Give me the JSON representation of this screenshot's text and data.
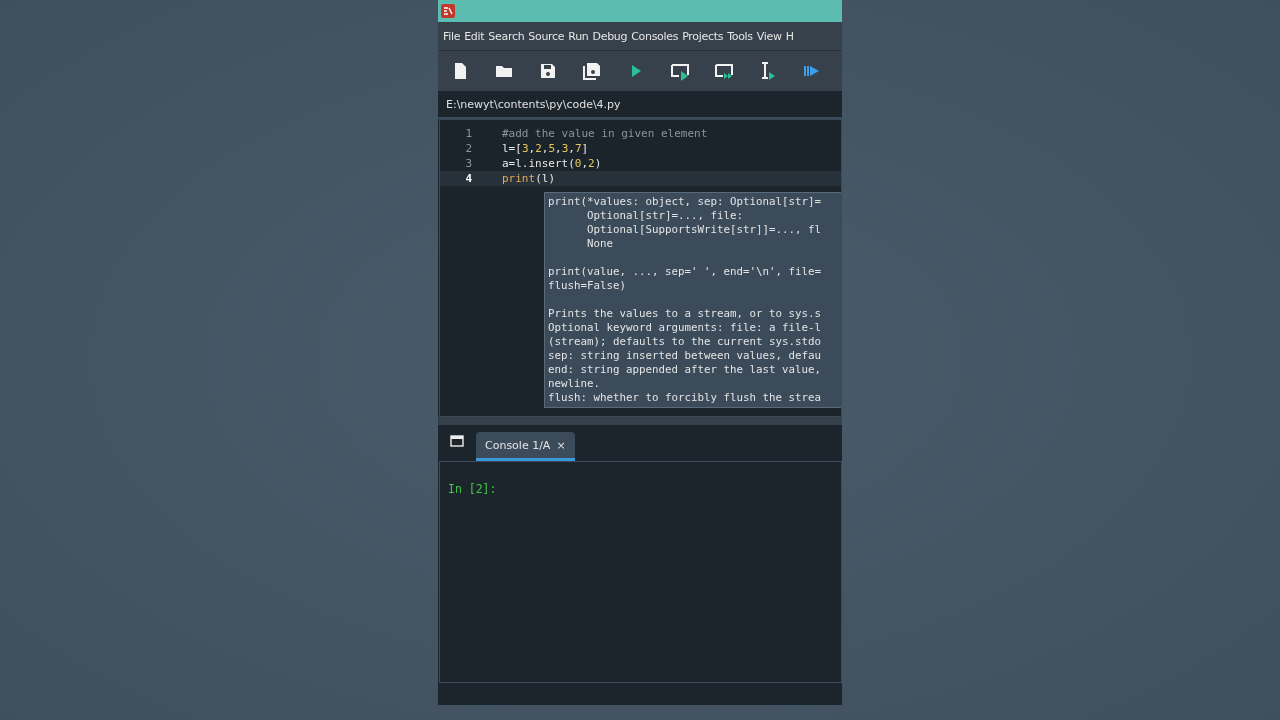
{
  "menu": [
    "File",
    "Edit",
    "Search",
    "Source",
    "Run",
    "Debug",
    "Consoles",
    "Projects",
    "Tools",
    "View",
    "H"
  ],
  "file_path": "E:\\newyt\\contents\\py\\code\\4.py",
  "editor": {
    "lines": [
      {
        "number": "1",
        "current": false,
        "tokens": [
          {
            "text": "#add the value in given element",
            "kind": "comment"
          }
        ]
      },
      {
        "number": "2",
        "current": false,
        "tokens": [
          {
            "text": "l=[",
            "kind": "plain"
          },
          {
            "text": "3",
            "kind": "number"
          },
          {
            "text": ",",
            "kind": "plain"
          },
          {
            "text": "2",
            "kind": "number"
          },
          {
            "text": ",",
            "kind": "plain"
          },
          {
            "text": "5",
            "kind": "number"
          },
          {
            "text": ",",
            "kind": "plain"
          },
          {
            "text": "3",
            "kind": "number"
          },
          {
            "text": ",",
            "kind": "plain"
          },
          {
            "text": "7",
            "kind": "number"
          },
          {
            "text": "]",
            "kind": "plain"
          }
        ]
      },
      {
        "number": "3",
        "current": false,
        "tokens": [
          {
            "text": "a=l.insert(",
            "kind": "plain"
          },
          {
            "text": "0",
            "kind": "number"
          },
          {
            "text": ",",
            "kind": "plain"
          },
          {
            "text": "2",
            "kind": "number"
          },
          {
            "text": ")",
            "kind": "plain"
          }
        ]
      },
      {
        "number": "4",
        "current": true,
        "tokens": [
          {
            "text": "print",
            "kind": "builtin"
          },
          {
            "text": "(l",
            "kind": "plain"
          },
          {
            "text": ")",
            "kind": "plain"
          }
        ]
      }
    ]
  },
  "calltip": {
    "paragraphs": [
      [
        "print(*values: object, sep: Optional[str]=",
        "      Optional[str]=..., file:",
        "      Optional[SupportsWrite[str]]=..., fl",
        "      None"
      ],
      [
        "print(value, ..., sep=' ', end='\\n', file=",
        "flush=False)"
      ],
      [
        "Prints the values to a stream, or to sys.s",
        "Optional keyword arguments: file: a file-l",
        "(stream); defaults to the current sys.stdo",
        "sep: string inserted between values, defau",
        "end: string appended after the last value,",
        "newline.",
        "flush: whether to forcibly flush the strea"
      ]
    ]
  },
  "console": {
    "tabs": [
      {
        "label": "Console 1/A",
        "close": "×",
        "selected": true
      }
    ],
    "prompt": "In [2]:"
  }
}
